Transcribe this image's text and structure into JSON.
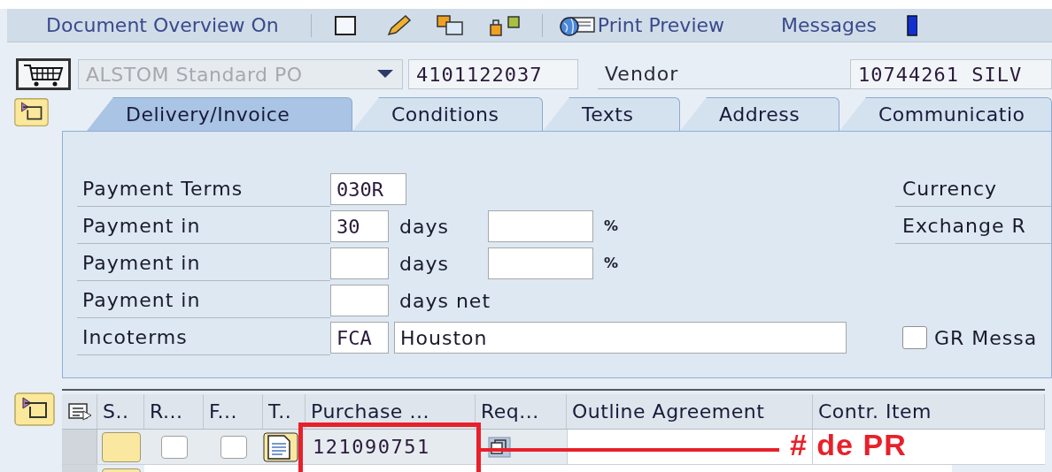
{
  "toolbar": {
    "document_overview": "Document Overview On",
    "print_preview": "Print Preview",
    "messages": "Messages"
  },
  "header": {
    "doc_type": "ALSTOM Standard PO",
    "doc_number": "4101122037",
    "vendor_label": "Vendor",
    "vendor_value": "10744261 SILV"
  },
  "tabs": [
    {
      "label": "Delivery/Invoice",
      "selected": true
    },
    {
      "label": "Conditions",
      "selected": false
    },
    {
      "label": "Texts",
      "selected": false
    },
    {
      "label": "Address",
      "selected": false
    },
    {
      "label": "Communicatio",
      "selected": false
    }
  ],
  "left_rows": [
    {
      "kind": "single",
      "label": "Payment Terms",
      "value": "030R"
    },
    {
      "kind": "days_percent",
      "label": "Payment in",
      "value": "30",
      "unit": "days",
      "percent": "%"
    },
    {
      "kind": "days_percent",
      "label": "Payment in",
      "unit": "days",
      "percent": "%"
    },
    {
      "kind": "days",
      "label": "Payment in",
      "unit": "days net"
    },
    {
      "kind": "incoterms",
      "label": "Incoterms",
      "value": "FCA",
      "location": "Houston"
    }
  ],
  "right_rows": [
    {
      "kind": "label",
      "label": "Currency"
    },
    {
      "kind": "label",
      "label": "Exchange R"
    },
    {
      "kind": "checkbox",
      "label": "GR Messa",
      "checked": false
    }
  ],
  "table": {
    "columns": [
      "S..",
      "R...",
      "F...",
      "T..",
      "Purchase ...",
      "Req...",
      "Outline Agreement",
      "Contr. Item"
    ],
    "rows": [
      {
        "purchase_requisition": "121090751",
        "r_checked": false,
        "f_checked": false
      }
    ]
  },
  "annotation": {
    "label": "# de PR"
  }
}
